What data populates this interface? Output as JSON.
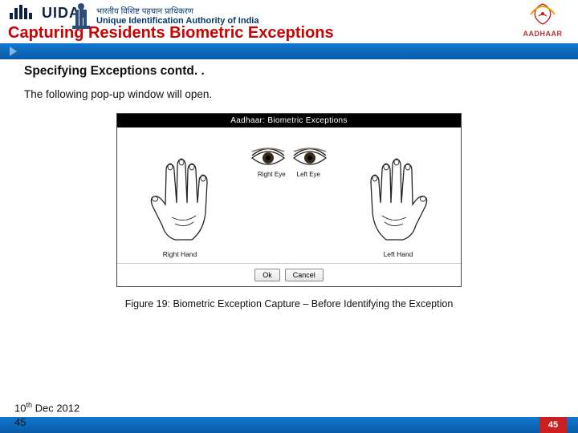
{
  "header": {
    "brand": "UIDAI",
    "emblem_hint": "ashoka-emblem",
    "subtitle_native": "भारतीय विशिष्ट पहचान प्राधिकरण",
    "subtitle_eng": "Unique Identification Authority of India",
    "aadhaar_label": "AADHAAR"
  },
  "title": "Capturing Residents Biometric Exceptions",
  "subhead": "Specifying Exceptions contd. .",
  "intro": "The following pop-up window will open.",
  "popup": {
    "title": "Aadhaar: Biometric Exceptions",
    "right_eye": "Right Eye",
    "left_eye": "Left Eye",
    "right_hand": "Right Hand",
    "left_hand": "Left Hand",
    "ok": "Ok",
    "cancel": "Cancel"
  },
  "caption": "Figure 19: Biometric Exception Capture – Before Identifying the Exception",
  "footer": {
    "date_day": "10",
    "date_suffix": "th",
    "date_rest": " Dec 2012",
    "big_num": "45",
    "slide_num": "45"
  }
}
